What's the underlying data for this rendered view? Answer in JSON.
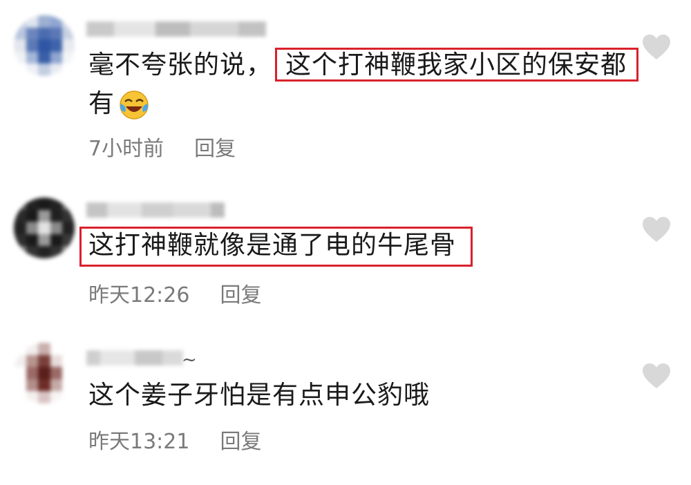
{
  "comments": [
    {
      "text_before": "毫不夸张的说，",
      "text_highlight": "这个打神鞭我家小区的保安都",
      "text_after": "有",
      "time": "7小时前",
      "reply_label": "回复",
      "emoji": "laughing-crying-emoji",
      "avatar_colors": [
        "#c9d3e6",
        "#dfe5ee",
        "#9db0d2",
        "#8fa6d0",
        "#d5dbe6",
        "#b8c5de",
        "#6c86bd",
        "#4b6db0",
        "#5a78b6",
        "#c8d1e3",
        "#e3e6ec",
        "#5b79b6",
        "#2f56a4",
        "#3e63aa",
        "#e8eaf0",
        "#f0f1f4",
        "#a4b6d8",
        "#3a5fa8",
        "#8fa6d0",
        "#f3f4f6",
        "#ffffff",
        "#eef1f6",
        "#c3cee3",
        "#e9ecf2",
        "#ffffff"
      ]
    },
    {
      "text_highlight": "这打神鞭就像是通了电的牛尾骨",
      "time": "昨天12:26",
      "reply_label": "回复",
      "avatar_colors": [
        "#555555",
        "#222222",
        "#1a1a1a",
        "#222222",
        "#666666",
        "#2a2a2a",
        "#1a1a1a",
        "#9a9a9a",
        "#202020",
        "#333333",
        "#222222",
        "#8a8a8a",
        "#e2e2e2",
        "#8a8a8a",
        "#222222",
        "#2e2e2e",
        "#1a1a1a",
        "#9a9a9a",
        "#1a1a1a",
        "#3a3a3a",
        "#777777",
        "#333333",
        "#222222",
        "#333333",
        "#888888"
      ]
    },
    {
      "text": "这个姜子牙怕是有点申公豹哦",
      "time": "昨天13:21",
      "reply_label": "回复",
      "username_suffix": "~",
      "avatar_colors": [
        "#ffffff",
        "#f2eeee",
        "#c9b0ae",
        "#ffffff",
        "#ffffff",
        "#f2eeee",
        "#b7958f",
        "#7a3f3a",
        "#e8dcdb",
        "#ffffff",
        "#ffffff",
        "#9b6a66",
        "#5a1f1b",
        "#9a6a66",
        "#ffffff",
        "#ffffff",
        "#b28e8a",
        "#6d2d28",
        "#c5aaa7",
        "#ffffff",
        "#ffffff",
        "#f5f0f0",
        "#d9c5c3",
        "#f8f4f4",
        "#ffffff"
      ]
    }
  ],
  "colors": {
    "highlight_border": "#d9212b",
    "meta_text": "#7a7a7a",
    "heart": "#d8d8d8"
  }
}
